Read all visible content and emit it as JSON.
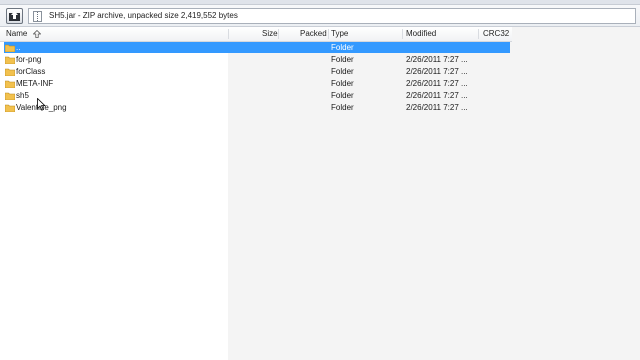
{
  "path_bar": {
    "archive_icon": "archive-icon",
    "up_icon": "up-folder-icon",
    "text": "SH5.jar - ZIP archive, unpacked size 2,419,552 bytes"
  },
  "columns": {
    "name": "Name",
    "size": "Size",
    "packed": "Packed",
    "type": "Type",
    "modified": "Modified",
    "crc": "CRC32"
  },
  "rows": [
    {
      "name": "..",
      "type": "Folder",
      "modified": "",
      "selected": true
    },
    {
      "name": "for-png",
      "type": "Folder",
      "modified": "2/26/2011 7:27 ..."
    },
    {
      "name": "forClass",
      "type": "Folder",
      "modified": "2/26/2011 7:27 ..."
    },
    {
      "name": "META-INF",
      "type": "Folder",
      "modified": "2/26/2011 7:27 ..."
    },
    {
      "name": "sh5",
      "type": "Folder",
      "modified": "2/26/2011 7:27 ..."
    },
    {
      "name": "Valentine_png",
      "type": "Folder",
      "modified": "2/26/2011 7:27 ..."
    }
  ],
  "colors": {
    "selection": "#3399ff",
    "folder": "#f2c14e"
  }
}
